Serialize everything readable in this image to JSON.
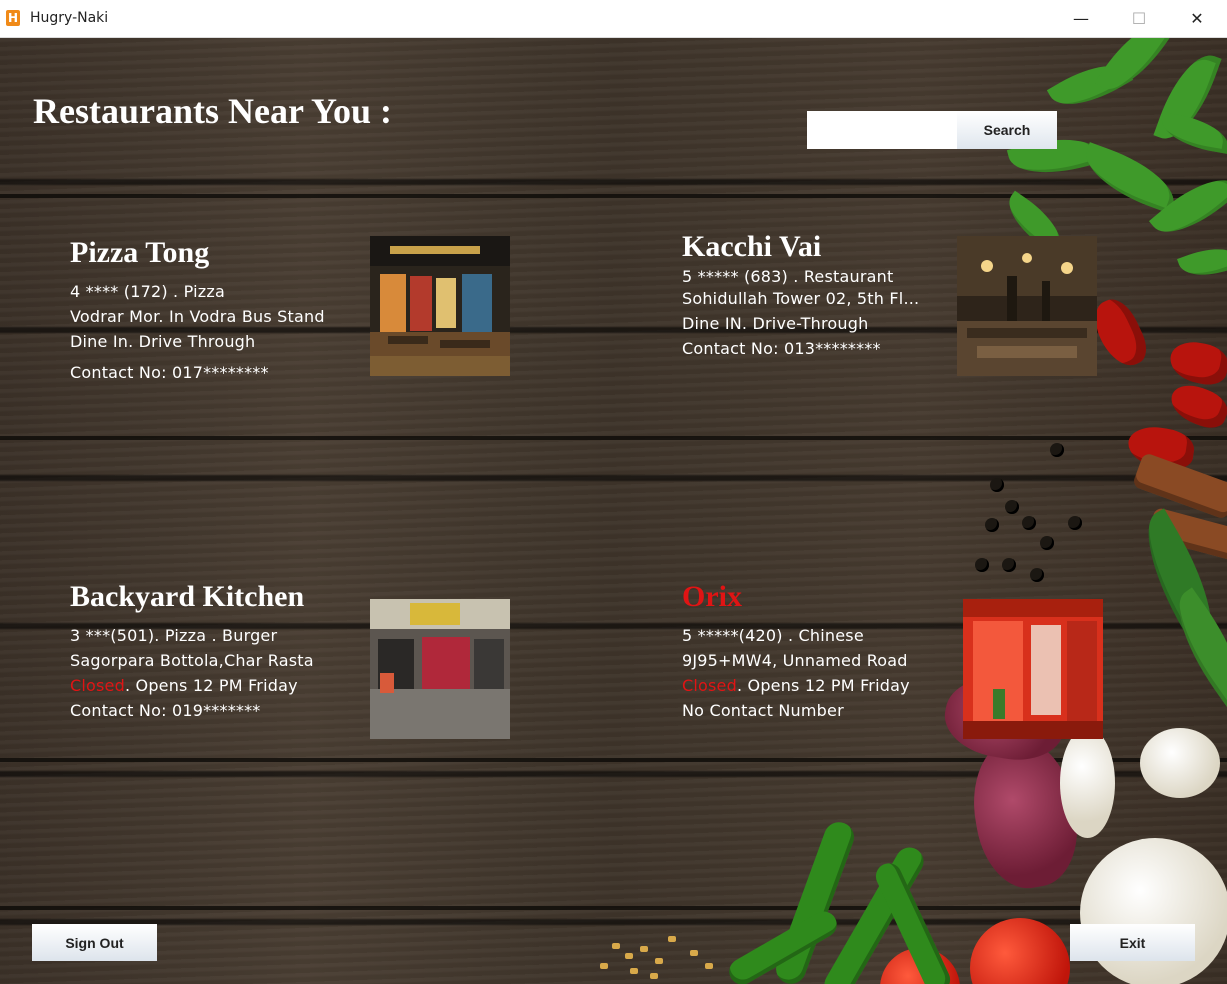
{
  "window": {
    "title": "Hugry-Naki",
    "icon_letter": "H",
    "controls": {
      "minimize": "—",
      "maximize": "☐",
      "close": "✕"
    }
  },
  "header": {
    "title": "Restaurants Near You :",
    "search_placeholder": "",
    "search_value": "",
    "search_label": "Search"
  },
  "colors": {
    "closed": "#e01414",
    "text": "#ffffff"
  },
  "restaurants": [
    {
      "name": "Pizza Tong",
      "rating_line": "4 **** (172) . Pizza",
      "address": "Vodrar Mor. In Vodra Bus Stand",
      "services": "Dine In. Drive Through",
      "contact": "Contact No: 017********"
    },
    {
      "name": "Kacchi Vai",
      "rating_line": "5 ***** (683) . Restaurant",
      "address": "Sohidullah Tower 02, 5th Fl...",
      "services": "Dine IN. Drive-Through",
      "contact": "Contact No: 013********"
    },
    {
      "name": "Backyard Kitchen",
      "rating_line": "3 ***(501). Pizza . Burger",
      "address": "Sagorpara Bottola,Char Rasta",
      "status_closed": "Closed",
      "status_rest": ". Opens 12 PM Friday",
      "contact": "Contact No: 019*******"
    },
    {
      "name": "Orix",
      "rating_line": "5 *****(420) . Chinese",
      "address": "9J95+MW4, Unnamed Road",
      "status_closed": "Closed",
      "status_rest": ". Opens 12 PM Friday",
      "contact": "No Contact Number"
    }
  ],
  "footer": {
    "sign_out_label": "Sign Out",
    "exit_label": "Exit"
  }
}
